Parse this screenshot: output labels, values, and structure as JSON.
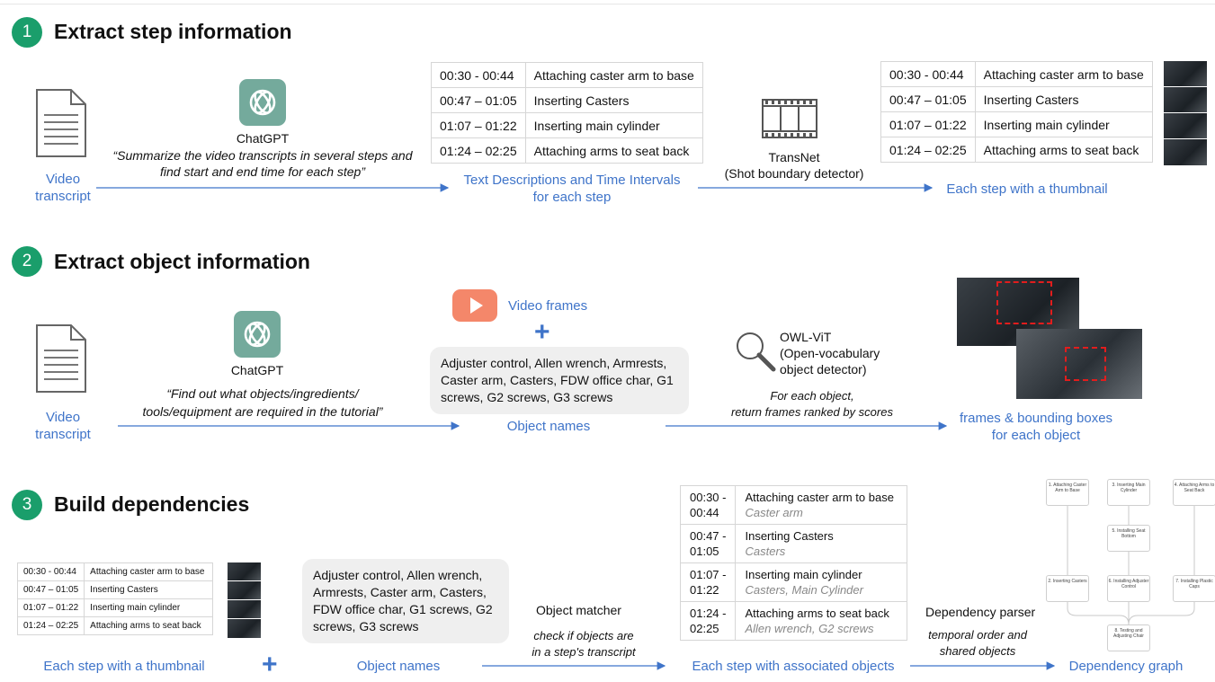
{
  "sections": [
    {
      "number": "1",
      "title": "Extract step information"
    },
    {
      "number": "2",
      "title": "Extract object information"
    },
    {
      "number": "3",
      "title": "Build dependencies"
    }
  ],
  "s1": {
    "video_transcript": [
      "Video",
      "transcript"
    ],
    "chatgpt_label": "ChatGPT",
    "prompt": [
      "“Summarize the video transcripts in several steps and",
      "find start and end time for each step”"
    ],
    "text_desc_label": [
      "Text Descriptions and Time Intervals",
      "for each step"
    ],
    "transnet_label": [
      "TransNet",
      "(Shot boundary detector)"
    ],
    "thumb_label": "Each step with a thumbnail",
    "steps": [
      {
        "time": "00:30 - 00:44",
        "desc": "Attaching caster arm to base"
      },
      {
        "time": "00:47 – 01:05",
        "desc": "Inserting Casters"
      },
      {
        "time": "01:07 – 01:22",
        "desc": "Inserting main cylinder"
      },
      {
        "time": "01:24 – 02:25",
        "desc": "Attaching arms to seat back"
      }
    ]
  },
  "s2": {
    "video_transcript": [
      "Video",
      "transcript"
    ],
    "chatgpt_label": "ChatGPT",
    "prompt": [
      "“Find out what objects/ingredients/",
      "tools/equipment are required in the tutorial”"
    ],
    "video_frames": "Video frames",
    "plus": "+",
    "object_list": "Adjuster control, Allen wrench, Armrests, Caster arm, Casters, FDW office char, G1 screws, G2 screws, G3 screws",
    "object_names": "Object names",
    "owl_label": [
      "OWL-ViT",
      "(Open-vocabulary",
      "object detector)"
    ],
    "owl_desc": [
      "For each object,",
      "return frames ranked by scores"
    ],
    "frames_label": [
      "frames & bounding boxes",
      "for each object"
    ]
  },
  "s3": {
    "thumb_label": "Each step with a thumbnail",
    "plus": "+",
    "object_list": "Adjuster control, Allen wrench, Armrests, Caster arm, Casters, FDW office char, G1 screws, G2 screws, G3 screws",
    "object_names": "Object names",
    "matcher_label": "Object matcher",
    "matcher_desc": [
      "check if objects are",
      "in a step's transcript"
    ],
    "assoc_label": "Each step with associated objects",
    "parser_label": "Dependency parser",
    "parser_desc": [
      "temporal order and",
      "shared objects"
    ],
    "graph_label": "Dependency graph",
    "steps": [
      {
        "time": "00:30 - 00:44",
        "desc": "Attaching caster arm to base"
      },
      {
        "time": "00:47 – 01:05",
        "desc": "Inserting Casters"
      },
      {
        "time": "01:07 – 01:22",
        "desc": "Inserting main cylinder"
      },
      {
        "time": "01:24 – 02:25",
        "desc": "Attaching arms to seat back"
      }
    ],
    "assoc_steps": [
      {
        "time_a": "00:30 -",
        "time_b": "00:44",
        "desc": "Attaching caster arm to base",
        "objects": "Caster arm"
      },
      {
        "time_a": "00:47 -",
        "time_b": "01:05",
        "desc": "Inserting Casters",
        "objects": "Casters"
      },
      {
        "time_a": "01:07 -",
        "time_b": "01:22",
        "desc": "Inserting main cylinder",
        "objects": "Casters, Main Cylinder"
      },
      {
        "time_a": "01:24 -",
        "time_b": "02:25",
        "desc": "Attaching arms to seat back",
        "objects": "Allen wrench, G2 screws"
      }
    ],
    "graph_nodes": [
      "1. Attaching Caster Arm to Base",
      "3. Inserting Main Cylinder",
      "4. Attaching Arms to Seat Back",
      "5. Installing Seat Bottom",
      "2. Inserting Casters",
      "6. Installing Adjuster Control",
      "7. Installing Plastic Caps",
      "8. Testing and Adjusting Chair"
    ]
  },
  "colors": {
    "accent_green": "#1a9e6b",
    "label_blue": "#3f74c9",
    "chatgpt_teal": "#74aa9c",
    "video_orange": "#f4876a",
    "bbox_red": "#e11d1d"
  }
}
